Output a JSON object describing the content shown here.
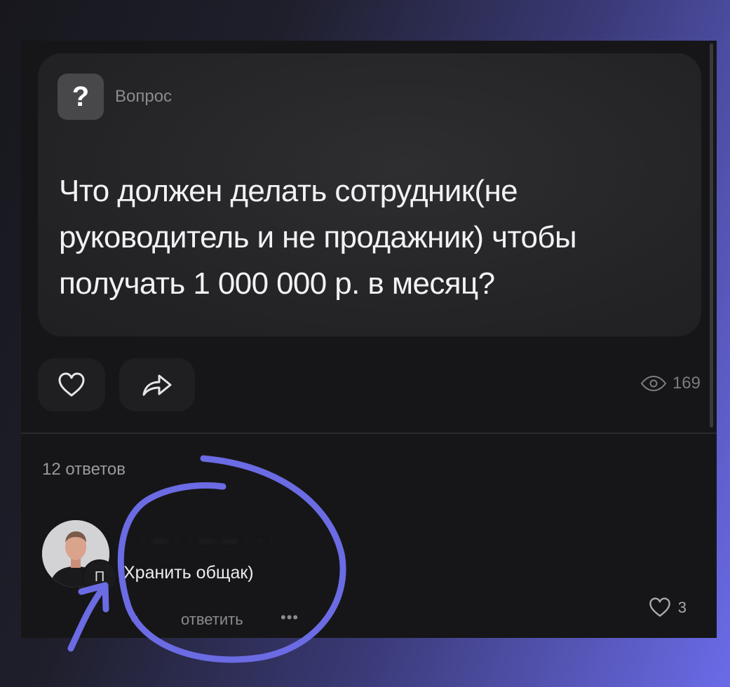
{
  "question": {
    "badge_icon": "question-mark-icon",
    "badge_symbol": "?",
    "label": "Вопрос",
    "text": "Что должен делать сотрудник(не руководитель и не продажник) чтобы получать 1 000 000 р. в месяц?"
  },
  "actions": {
    "like_icon": "heart-outline-icon",
    "share_icon": "share-arrow-icon",
    "views_icon": "eye-icon",
    "views_count": "169"
  },
  "answers": {
    "count_label": "12 ответов"
  },
  "comment": {
    "author_name": "· — · · — — · · ·",
    "badge_text": "П",
    "text": "Хранить общак)",
    "time": "ч",
    "reply_label": "ответить",
    "more_label": "•••",
    "likes": "3"
  },
  "colors": {
    "annotation": "#6b6be4",
    "card_bg": "#232325",
    "panel_bg": "#161618"
  }
}
